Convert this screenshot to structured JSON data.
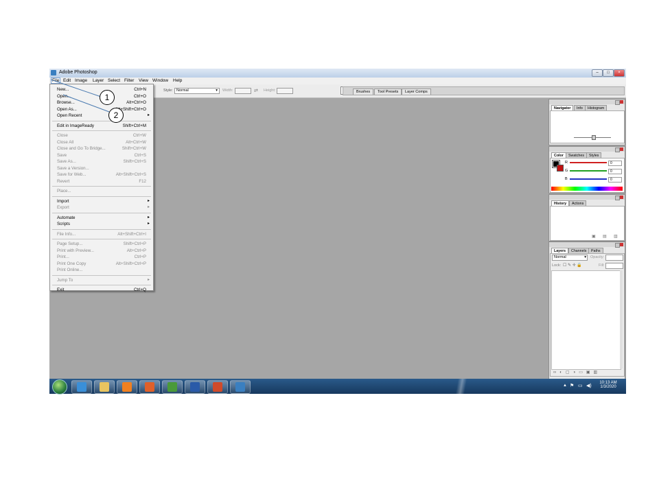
{
  "window": {
    "title": "Adobe Photoshop"
  },
  "menubar": [
    "File",
    "Edit",
    "Image",
    "Layer",
    "Select",
    "Filter",
    "View",
    "Window",
    "Help"
  ],
  "options": {
    "style_label": "Style:",
    "style_value": "Normal",
    "width_label": "Width:",
    "height_label": "Height:",
    "well_tabs": [
      "Brushes",
      "Tool Presets",
      "Layer Comps"
    ]
  },
  "file_menu": [
    {
      "label": "New...",
      "shortcut": "Ctrl+N",
      "disabled": false
    },
    {
      "label": "Open...",
      "shortcut": "Ctrl+O",
      "disabled": false
    },
    {
      "label": "Browse...",
      "shortcut": "Alt+Ctrl+O",
      "disabled": false
    },
    {
      "label": "Open As...",
      "shortcut": "Alt+Shift+Ctrl+O",
      "disabled": false
    },
    {
      "label": "Open Recent",
      "shortcut": "",
      "disabled": false,
      "submenu": true
    },
    {
      "label": "Edit in ImageReady",
      "shortcut": "Shift+Ctrl+M",
      "disabled": false
    },
    {
      "label": "Close",
      "shortcut": "Ctrl+W",
      "disabled": true
    },
    {
      "label": "Close All",
      "shortcut": "Alt+Ctrl+W",
      "disabled": true
    },
    {
      "label": "Close and Go To Bridge...",
      "shortcut": "Shift+Ctrl+W",
      "disabled": true
    },
    {
      "label": "Save",
      "shortcut": "Ctrl+S",
      "disabled": true
    },
    {
      "label": "Save As...",
      "shortcut": "Shift+Ctrl+S",
      "disabled": true
    },
    {
      "label": "Save a Version...",
      "shortcut": "",
      "disabled": true
    },
    {
      "label": "Save for Web...",
      "shortcut": "Alt+Shift+Ctrl+S",
      "disabled": true
    },
    {
      "label": "Revert",
      "shortcut": "F12",
      "disabled": true
    },
    {
      "label": "Place...",
      "shortcut": "",
      "disabled": true
    },
    {
      "label": "Import",
      "shortcut": "",
      "disabled": false,
      "submenu": true
    },
    {
      "label": "Export",
      "shortcut": "",
      "disabled": true,
      "submenu": true
    },
    {
      "label": "Automate",
      "shortcut": "",
      "disabled": false,
      "submenu": true
    },
    {
      "label": "Scripts",
      "shortcut": "",
      "disabled": false,
      "submenu": true
    },
    {
      "label": "File Info...",
      "shortcut": "Alt+Shift+Ctrl+I",
      "disabled": true
    },
    {
      "label": "Page Setup...",
      "shortcut": "Shift+Ctrl+P",
      "disabled": true
    },
    {
      "label": "Print with Preview...",
      "shortcut": "Alt+Ctrl+P",
      "disabled": true
    },
    {
      "label": "Print...",
      "shortcut": "Ctrl+P",
      "disabled": true
    },
    {
      "label": "Print One Copy",
      "shortcut": "Alt+Shift+Ctrl+P",
      "disabled": true
    },
    {
      "label": "Print Online...",
      "shortcut": "",
      "disabled": true
    },
    {
      "label": "Jump To",
      "shortcut": "",
      "disabled": true,
      "submenu": true
    },
    {
      "label": "Exit",
      "shortcut": "Ctrl+Q",
      "disabled": false
    }
  ],
  "panels": {
    "navigator": [
      "Navigator",
      "Info",
      "Histogram"
    ],
    "color": [
      "Color",
      "Swatches",
      "Styles"
    ],
    "color_channels": [
      {
        "label": "R",
        "value": "0",
        "color": "#d02020"
      },
      {
        "label": "G",
        "value": "0",
        "color": "#20a020"
      },
      {
        "label": "B",
        "value": "0",
        "color": "#2030c0"
      }
    ],
    "history": [
      "History",
      "Actions"
    ],
    "layers": [
      "Layers",
      "Channels",
      "Paths"
    ],
    "layers_blend": "Normal",
    "layers_opacity_label": "Opacity:",
    "layers_lock_label": "Lock:",
    "layers_fill_label": "Fill:"
  },
  "callouts": [
    "1",
    "2"
  ],
  "taskbar": {
    "time": "10:13 AM",
    "date": "1/3/2020",
    "apps": [
      {
        "name": "internet-explorer",
        "color": "#3a8fd8"
      },
      {
        "name": "file-explorer",
        "color": "#e8c460"
      },
      {
        "name": "media-player",
        "color": "#f08020"
      },
      {
        "name": "firefox",
        "color": "#e0602a"
      },
      {
        "name": "chrome",
        "color": "#4a9a3a"
      },
      {
        "name": "word",
        "color": "#2a5aa8"
      },
      {
        "name": "powerpoint",
        "color": "#d04a2a"
      },
      {
        "name": "photoshop",
        "color": "#3a7fc0"
      }
    ]
  }
}
